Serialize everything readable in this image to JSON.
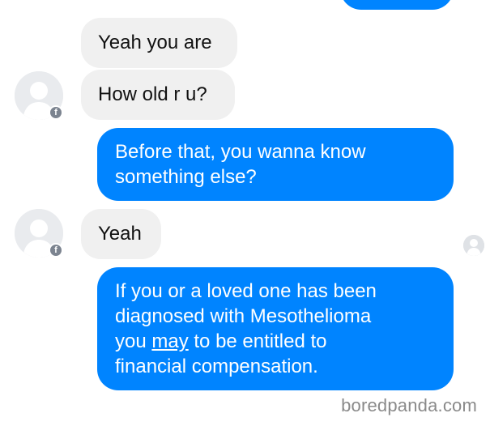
{
  "thread": {
    "messages": [
      {
        "from": "them",
        "text": "Yeah you are"
      },
      {
        "from": "them",
        "text": "How old r u?"
      },
      {
        "from": "me",
        "lines": [
          "Before that, you wanna know",
          "something else?"
        ]
      },
      {
        "from": "them",
        "text": "Yeah"
      },
      {
        "from": "me",
        "lines": [
          "If you or a loved one has been",
          "diagnosed with Mesothelioma"
        ],
        "line3_before": "you ",
        "line3_underlined": "may",
        "line3_after": " to be entitled to",
        "line4": "financial compensation."
      }
    ]
  },
  "avatars": {
    "contact_icon": "default-profile-icon",
    "badge_icon": "facebook-badge-icon",
    "badge_glyph": "f",
    "read_receipt_icon": "seen-avatar-icon"
  },
  "watermark": {
    "text": "boredpanda.com"
  },
  "colors": {
    "outgoing_bubble": "#0084ff",
    "incoming_bubble": "#f0f0f0",
    "avatar_bg": "#e9ebee",
    "watermark": "#8a8a8a"
  }
}
